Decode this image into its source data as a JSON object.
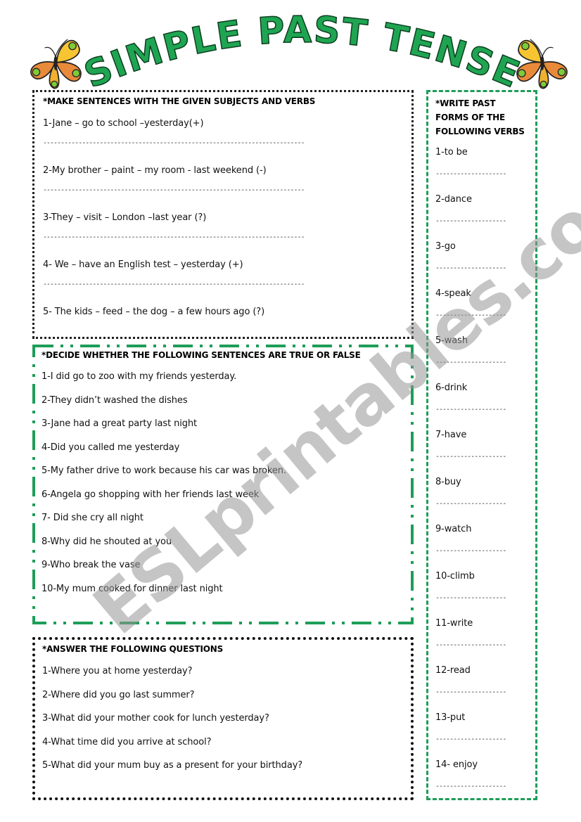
{
  "title": "SIMPLE PAST TENSE",
  "colors": {
    "title_green": "#1fa552",
    "border_green": "#1e9d58",
    "watermark_gray": "#969696"
  },
  "decorations": {
    "left_icon": "butterfly-icon",
    "right_icon": "butterfly-icon"
  },
  "watermark": "ESLprintables.com",
  "section_make_sentences": {
    "heading": "*MAKE SENTENCES WITH THE GIVEN SUBJECTS AND VERBS",
    "items": [
      {
        "prompt": "1-Jane – go to school –yesterday(+)",
        "answer": "--------------------------------------------------------------------------"
      },
      {
        "prompt": "2-My brother – paint – my room - last weekend (-)",
        "answer": "--------------------------------------------------------------------------"
      },
      {
        "prompt": "3-They – visit – London –last year (?)",
        "answer": "--------------------------------------------------------------------------"
      },
      {
        "prompt": "4- We – have an English test – yesterday (+)",
        "answer": "--------------------------------------------------------------------------"
      },
      {
        "prompt": "5- The kids – feed – the dog – a few hours ago (?)",
        "answer": ""
      }
    ]
  },
  "section_true_false": {
    "heading": "*DECIDE WHETHER THE FOLLOWING SENTENCES ARE TRUE OR FALSE",
    "items": [
      "1-I did go to zoo with my friends yesterday.",
      "2-They didn’t washed the dishes",
      "3-Jane had a great party last night",
      "4-Did you called me yesterday",
      "5-My father drive to work because his car was broken.",
      "6-Angela go shopping with her friends last week",
      "7- Did she cry all night",
      "8-Why did he shouted at you",
      "9-Who break the vase",
      "10-My mum cooked for dinner last night"
    ]
  },
  "section_questions": {
    "heading": "*ANSWER THE FOLLOWING QUESTIONS",
    "items": [
      "1-Where you at home yesterday?",
      "2-Where did you go last summer?",
      "3-What did your mother  cook for lunch yesterday?",
      "4-What time did you arrive at school?",
      "5-What did your mum buy as a present for your birthday?"
    ]
  },
  "section_past_forms": {
    "heading": "*WRITE PAST FORMS OF THE FOLLOWING VERBS",
    "answer_line": "--------------------",
    "items": [
      "1-to be",
      "2-dance",
      "3-go",
      "4-speak",
      "5-wash",
      "6-drink",
      "7-have",
      "8-buy",
      "9-watch",
      "10-climb",
      "11-write",
      "12-read",
      "13-put",
      "14- enjoy"
    ]
  }
}
